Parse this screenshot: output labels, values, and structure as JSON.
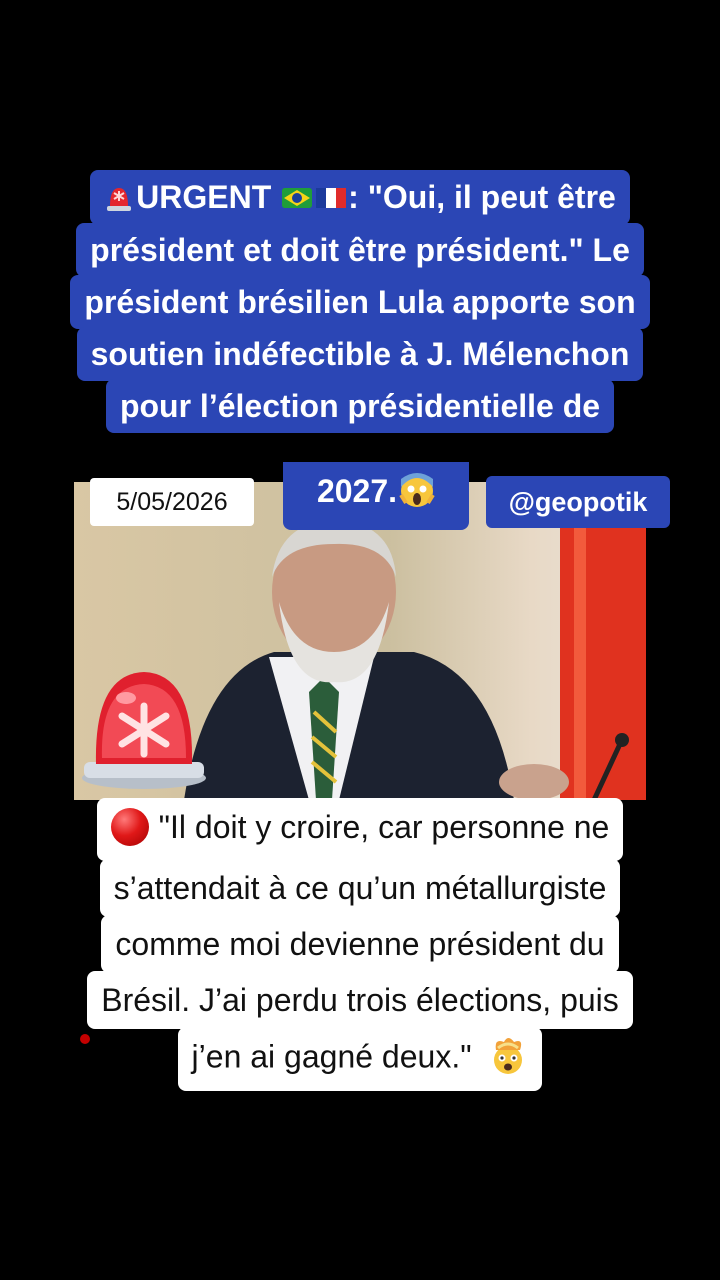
{
  "top_caption": {
    "line1_text": "URGENT",
    "line1_rest": ": \"Oui, il peut être",
    "line2": "président et doit être président.\" Le",
    "line3": "président brésilien Lula apporte son",
    "line4": "soutien indéfectible à J. Mélenchon",
    "line5": "pour l’élection présidentielle de",
    "line6": "2027."
  },
  "overlays": {
    "date": "5/05/2026",
    "handle": "@geopotik"
  },
  "bottom_caption": {
    "line1": "\"Il doit y croire, car personne ne",
    "line2": "s’attendait à ce qu’un métallurgiste",
    "line3": "comme moi devienne président du",
    "line4": "Brésil. J’ai perdu trois élections, puis",
    "line5": "j’en ai gagné deux.\""
  },
  "icons": {
    "siren": "rotating-light-icon",
    "flag_brazil": "brazil-flag-icon",
    "flag_france": "france-flag-icon",
    "shocked": "screaming-face-icon",
    "red_circle": "red-circle-icon",
    "mind_blown": "exploding-head-icon"
  },
  "colors": {
    "caption_blue": "#2b46b5",
    "background": "#000000",
    "white_caption": "#ffffff"
  }
}
